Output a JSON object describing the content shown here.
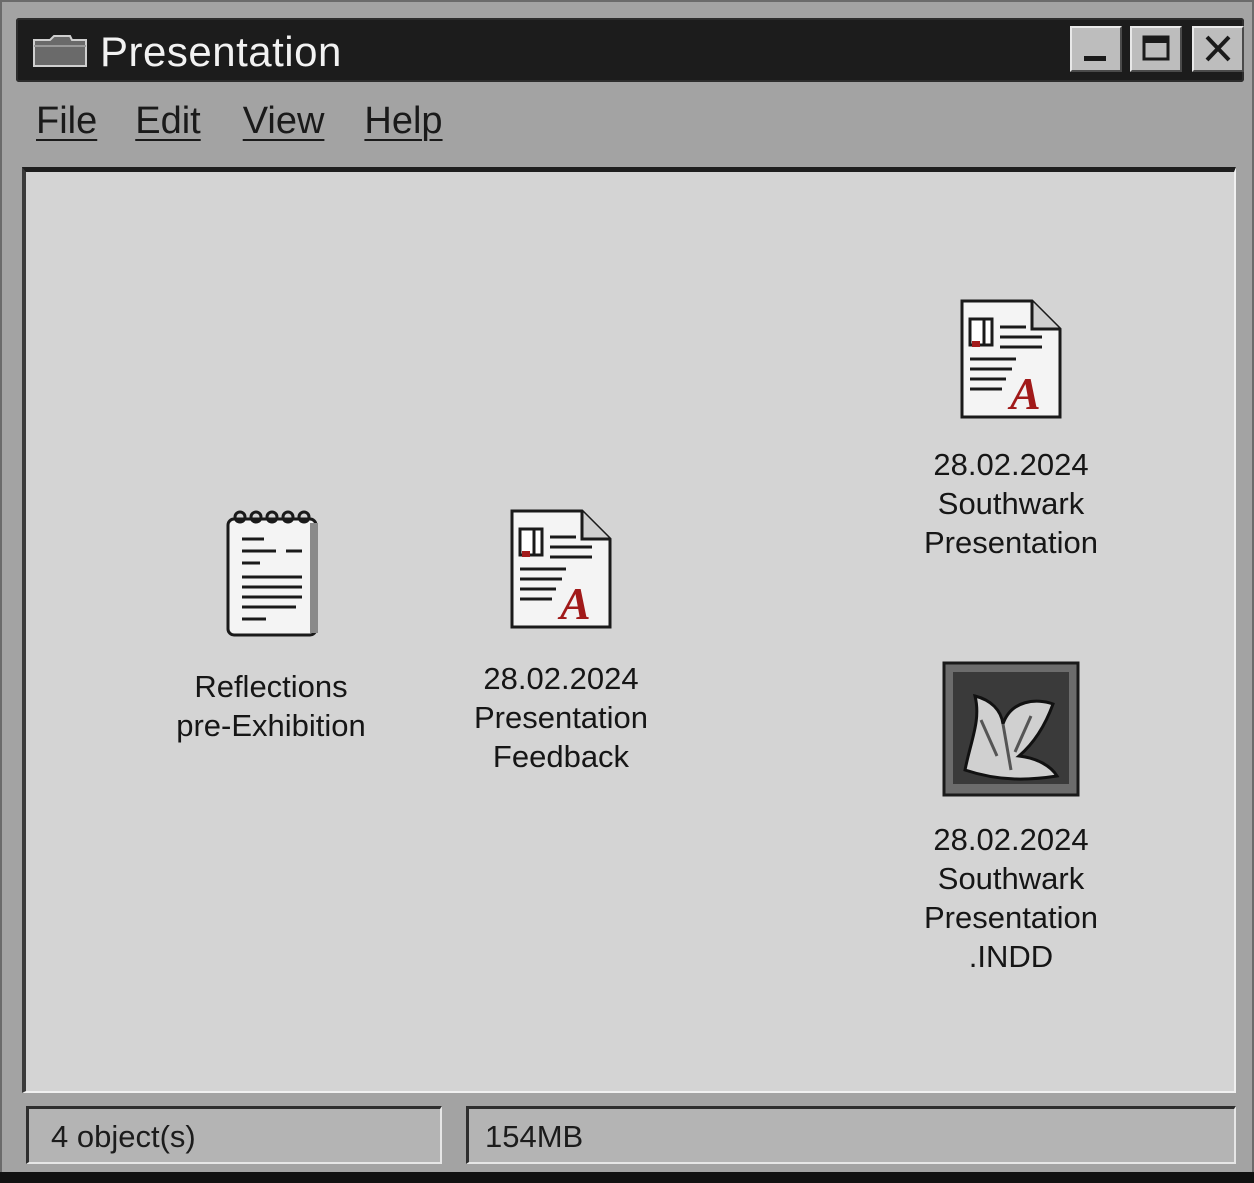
{
  "window": {
    "title": "Presentation",
    "title_icon": "folder-icon",
    "controls": [
      "minimize-icon",
      "maximize-icon",
      "close-icon"
    ]
  },
  "menu": {
    "items": [
      "File",
      "Edit",
      "View",
      "Help"
    ]
  },
  "icons": [
    {
      "label": "Reflections\npre-Exhibition",
      "icon": "notepad-icon"
    },
    {
      "label": "28.02.2024\nPresentation\nFeedback",
      "icon": "pdf-document-icon"
    },
    {
      "label": "28.02.2024\nSouthwark\nPresentation",
      "icon": "pdf-document-icon"
    },
    {
      "label": "28.02.2024\nSouthwark\nPresentation\n.INDD",
      "icon": "indesign-image-icon"
    }
  ],
  "status": {
    "objects": "4 object(s)",
    "size": "154MB"
  },
  "colors": {
    "titlebar": "#1c1c1c",
    "window": "#a3a3a3",
    "content": "#d4d4d4",
    "pdf_accent": "#a11a1a"
  }
}
